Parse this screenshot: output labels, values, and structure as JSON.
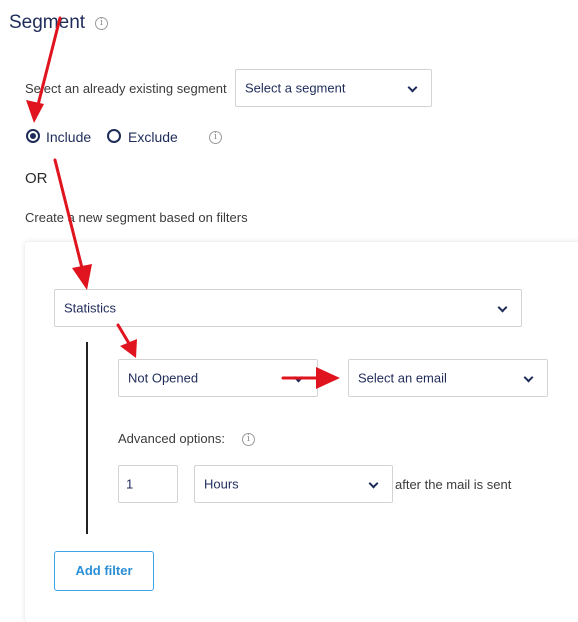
{
  "section": {
    "title": "Segment"
  },
  "existing_segment": {
    "label": "Select an already existing segment",
    "select_value": "Select a segment"
  },
  "mode": {
    "include_label": "Include",
    "exclude_label": "Exclude",
    "selected": "include"
  },
  "or_label": "OR",
  "new_segment_label": "Create a new segment based on filters",
  "filter": {
    "category_value": "Statistics",
    "condition_value": "Not Opened",
    "email_value": "Select an email",
    "advanced_label": "Advanced options:",
    "amount_value": "1",
    "unit_value": "Hours",
    "suffix": "after the mail is sent"
  },
  "add_filter_label": "Add filter",
  "colors": {
    "accent": "#1f2c5a",
    "button": "#2a8fd6",
    "annotation_arrow": "#e0141e"
  }
}
